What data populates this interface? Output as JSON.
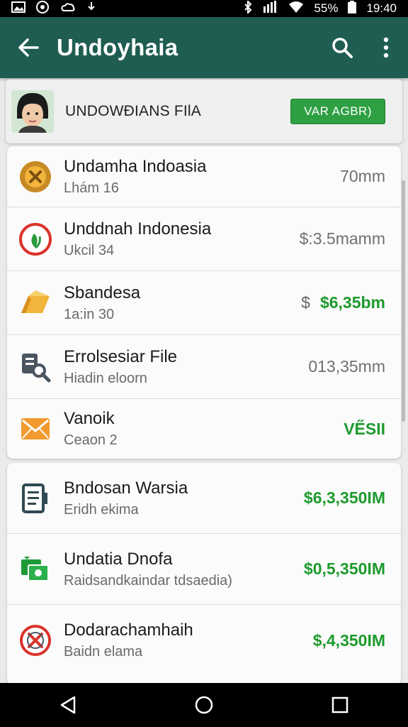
{
  "status_bar": {
    "battery": "55%",
    "time": "19:40",
    "icons_left": [
      "image-icon",
      "whatsapp-icon",
      "cloud-icon",
      "download-icon"
    ],
    "icons_right": [
      "bluetooth-icon",
      "signal-icon",
      "wifi-icon",
      "battery-icon"
    ]
  },
  "app_bar": {
    "title": "Undoyhaia",
    "color": "#1f5d52"
  },
  "account": {
    "name": "UNDOWÐIANS FIlA",
    "button_label": "VAR AGBR)",
    "button_color": "#2ea043"
  },
  "card1": [
    {
      "icon": "x-coin-icon",
      "title": "Undamha Indoasia",
      "subtitle": "Lhám 16",
      "amount": "70mm",
      "amount_green": false
    },
    {
      "icon": "leaf-circle-icon",
      "title": "Unddnah Indonesia",
      "subtitle": "Ukcil 34",
      "amount": "$:3.5mamm",
      "amount_green": false
    },
    {
      "icon": "gold-bar-icon",
      "title": "Sbandesa",
      "subtitle": "1a:in 30",
      "currency": "$",
      "amount": "$6,35bm",
      "amount_green": true
    },
    {
      "icon": "document-search-icon",
      "title": "Errolsesiar File",
      "subtitle": "Hiadin eloorn",
      "amount": "013,35mm",
      "amount_green": false
    },
    {
      "icon": "envelope-icon",
      "title": "Vanoik",
      "subtitle": "Ceaon 2",
      "amount": "VE̋SII",
      "amount_green": true
    }
  ],
  "card2": [
    {
      "icon": "receipt-icon",
      "title": "Bndosan Warsia",
      "subtitle": "Eridh ekima",
      "amount": "$6,3,350IM",
      "amount_green": true
    },
    {
      "icon": "money-transfer-icon",
      "title": "Undatia Dnofa",
      "subtitle": "Raidsandkaindar tdsaedia)",
      "amount": "$0,5,350IM",
      "amount_green": true
    },
    {
      "icon": "cancel-circle-icon",
      "title": "Dodarachamhaih",
      "subtitle": "Baidn elama",
      "amount": "$,4,350IM",
      "amount_green": true
    }
  ],
  "colors": {
    "green_amount": "#1e9a2e",
    "gray_amount": "#707070"
  }
}
